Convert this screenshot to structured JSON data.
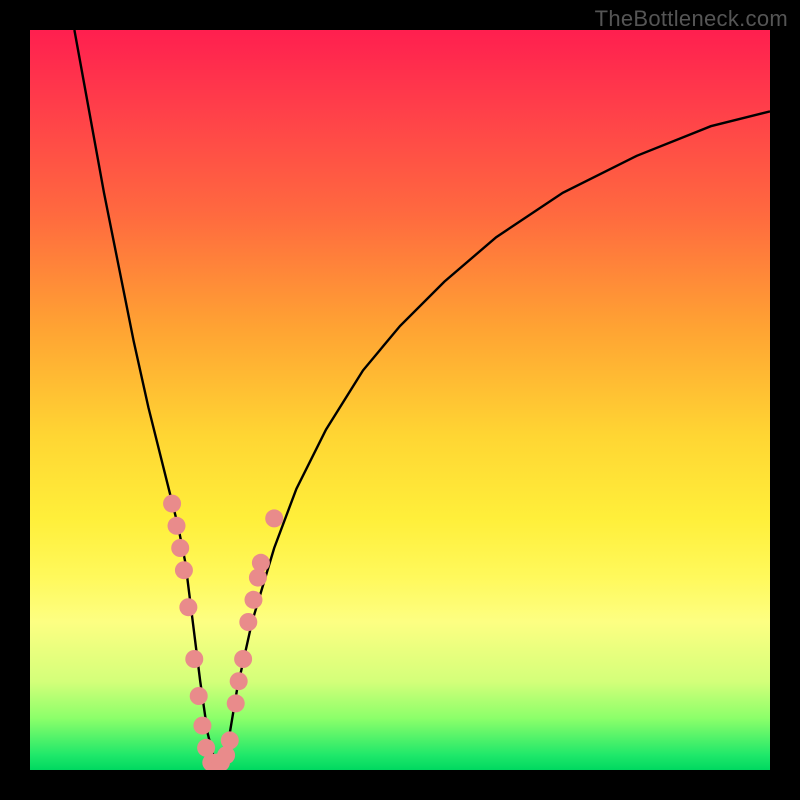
{
  "watermark": "TheBottleneck.com",
  "chart_data": {
    "type": "line",
    "title": "",
    "xlabel": "",
    "ylabel": "",
    "xlim": [
      0,
      100
    ],
    "ylim": [
      0,
      100
    ],
    "grid": false,
    "legend": false,
    "curve": {
      "name": "bottleneck-curve",
      "x": [
        6,
        8,
        10,
        12,
        14,
        16,
        18,
        20,
        21,
        22,
        23,
        24,
        25,
        26,
        27,
        28,
        30,
        33,
        36,
        40,
        45,
        50,
        56,
        63,
        72,
        82,
        92,
        100
      ],
      "y": [
        100,
        89,
        78,
        68,
        58,
        49,
        41,
        33,
        28,
        20,
        12,
        5,
        1,
        1,
        5,
        11,
        20,
        30,
        38,
        46,
        54,
        60,
        66,
        72,
        78,
        83,
        87,
        89
      ]
    },
    "markers": {
      "name": "highlighted-points",
      "color": "#e98b8b",
      "points": [
        {
          "x": 19.2,
          "y": 36
        },
        {
          "x": 19.8,
          "y": 33
        },
        {
          "x": 20.3,
          "y": 30
        },
        {
          "x": 20.8,
          "y": 27
        },
        {
          "x": 21.4,
          "y": 22
        },
        {
          "x": 22.2,
          "y": 15
        },
        {
          "x": 22.8,
          "y": 10
        },
        {
          "x": 23.3,
          "y": 6
        },
        {
          "x": 23.8,
          "y": 3
        },
        {
          "x": 24.5,
          "y": 1
        },
        {
          "x": 25.2,
          "y": 1
        },
        {
          "x": 25.8,
          "y": 1
        },
        {
          "x": 26.5,
          "y": 2
        },
        {
          "x": 27.0,
          "y": 4
        },
        {
          "x": 27.8,
          "y": 9
        },
        {
          "x": 28.2,
          "y": 12
        },
        {
          "x": 28.8,
          "y": 15
        },
        {
          "x": 29.5,
          "y": 20
        },
        {
          "x": 30.2,
          "y": 23
        },
        {
          "x": 30.8,
          "y": 26
        },
        {
          "x": 31.2,
          "y": 28
        },
        {
          "x": 33.0,
          "y": 34
        }
      ]
    }
  }
}
